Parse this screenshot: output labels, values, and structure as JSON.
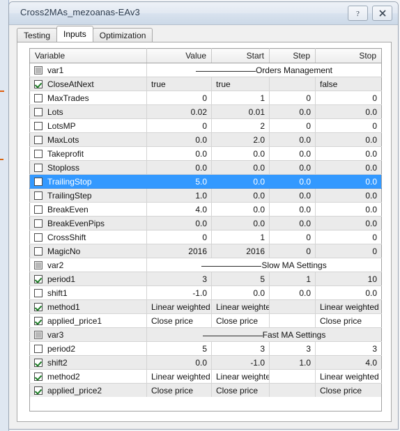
{
  "window": {
    "title": "Cross2MAs_mezoanas-EAv3",
    "help_button": "?",
    "close_button": "x"
  },
  "tabs": [
    {
      "label": "Testing",
      "active": false
    },
    {
      "label": "Inputs",
      "active": true
    },
    {
      "label": "Optimization",
      "active": false
    }
  ],
  "table": {
    "headers": [
      "Variable",
      "Value",
      "Start",
      "Step",
      "Stop"
    ],
    "rows": [
      {
        "name": "var1",
        "checkbox": "disabled",
        "section": "Orders Management"
      },
      {
        "name": "CloseAtNext",
        "checkbox": "checked",
        "value": "true",
        "start": "true",
        "step": "",
        "stop": "false",
        "align": "text"
      },
      {
        "name": "MaxTrades",
        "checkbox": "unchecked",
        "value": "0",
        "start": "1",
        "step": "0",
        "stop": "0",
        "align": "num"
      },
      {
        "name": "Lots",
        "checkbox": "unchecked",
        "value": "0.02",
        "start": "0.01",
        "step": "0.0",
        "stop": "0.0",
        "align": "num"
      },
      {
        "name": "LotsMP",
        "checkbox": "unchecked",
        "value": "0",
        "start": "2",
        "step": "0",
        "stop": "0",
        "align": "num"
      },
      {
        "name": "MaxLots",
        "checkbox": "unchecked",
        "value": "0.0",
        "start": "2.0",
        "step": "0.0",
        "stop": "0.0",
        "align": "num"
      },
      {
        "name": "Takeprofit",
        "checkbox": "unchecked",
        "value": "0.0",
        "start": "0.0",
        "step": "0.0",
        "stop": "0.0",
        "align": "num"
      },
      {
        "name": "Stoploss",
        "checkbox": "unchecked",
        "value": "0.0",
        "start": "0.0",
        "step": "0.0",
        "stop": "0.0",
        "align": "num"
      },
      {
        "name": "TrailingStop",
        "checkbox": "unchecked",
        "value": "5.0",
        "start": "0.0",
        "step": "0.0",
        "stop": "0.0",
        "align": "num",
        "selected": true
      },
      {
        "name": "TrailingStep",
        "checkbox": "unchecked",
        "value": "1.0",
        "start": "0.0",
        "step": "0.0",
        "stop": "0.0",
        "align": "num"
      },
      {
        "name": "BreakEven",
        "checkbox": "unchecked",
        "value": "4.0",
        "start": "0.0",
        "step": "0.0",
        "stop": "0.0",
        "align": "num"
      },
      {
        "name": "BreakEvenPips",
        "checkbox": "unchecked",
        "value": "0.0",
        "start": "0.0",
        "step": "0.0",
        "stop": "0.0",
        "align": "num"
      },
      {
        "name": "CrossShift",
        "checkbox": "unchecked",
        "value": "0",
        "start": "1",
        "step": "0",
        "stop": "0",
        "align": "num"
      },
      {
        "name": "MagicNo",
        "checkbox": "unchecked",
        "value": "2016",
        "start": "2016",
        "step": "0",
        "stop": "0",
        "align": "num"
      },
      {
        "name": "var2",
        "checkbox": "disabled",
        "section": "Slow MA Settings"
      },
      {
        "name": "period1",
        "checkbox": "checked",
        "value": "3",
        "start": "5",
        "step": "1",
        "stop": "10",
        "align": "num"
      },
      {
        "name": "shift1",
        "checkbox": "unchecked",
        "value": "-1.0",
        "start": "0.0",
        "step": "0.0",
        "stop": "0.0",
        "align": "num"
      },
      {
        "name": "method1",
        "checkbox": "checked",
        "value": "Linear weighted",
        "start": "Linear weighted",
        "step": "",
        "stop": "Linear weighted",
        "align": "text"
      },
      {
        "name": "applied_price1",
        "checkbox": "checked",
        "value": "Close price",
        "start": "Close price",
        "step": "",
        "stop": "Close price",
        "align": "text"
      },
      {
        "name": "var3",
        "checkbox": "disabled",
        "section": "Fast MA Settings"
      },
      {
        "name": "period2",
        "checkbox": "unchecked",
        "value": "5",
        "start": "3",
        "step": "3",
        "stop": "3",
        "align": "num"
      },
      {
        "name": "shift2",
        "checkbox": "checked",
        "value": "0.0",
        "start": "-1.0",
        "step": "1.0",
        "stop": "4.0",
        "align": "num"
      },
      {
        "name": "method2",
        "checkbox": "checked",
        "value": "Linear weighted",
        "start": "Linear weighted",
        "step": "",
        "stop": "Linear weighted",
        "align": "text"
      },
      {
        "name": "applied_price2",
        "checkbox": "checked",
        "value": "Close price",
        "start": "Close price",
        "step": "",
        "stop": "Close price",
        "align": "text"
      }
    ]
  },
  "colors": {
    "selection": "#3399ff",
    "alt_row": "#ebebeb",
    "check_green": "#1a7a23",
    "titlebar": "#d8e2ee"
  }
}
